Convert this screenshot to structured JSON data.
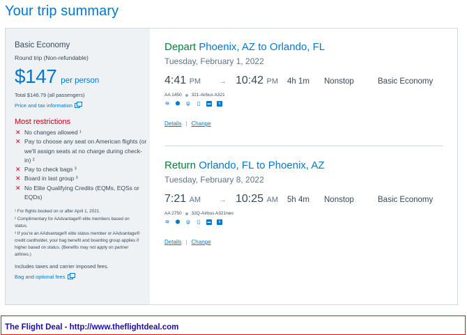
{
  "page": {
    "title": "Your trip summary"
  },
  "fare": {
    "name": "Basic Economy",
    "trip_type": "Round trip (Non-refundable)",
    "price": "$147",
    "per_person": "per person",
    "total": "Total $146.79 (all passengers)",
    "price_info_link": "Price and tax information",
    "restrictions_title": "Most restrictions",
    "restrictions": [
      "No changes allowed ¹",
      "Pay to choose any seat on American flights (or we'll assign seats at no charge during check-in) ²",
      "Pay to check bags ³",
      "Board in last group ³",
      "No Elite Qualifying Credits (EQMs, EQSs or EQDs)"
    ],
    "footnotes": [
      "¹ For flights booked on or after April 1, 2021.",
      "² Complimentary for AAdvantage® elite members based on status.",
      "³ If you're an AAdvantage® elite status member or AAdvantage® credit cardholder, your bag benefit and boarding group applies if higher based on status. (Benefits may not apply on partner airlines.)"
    ],
    "taxes_note": "Includes taxes and carrier imposed fees.",
    "bag_link": "Bag and optional fees"
  },
  "segments": [
    {
      "direction": "Depart",
      "route": "Phoenix, AZ to Orlando, FL",
      "date": "Tuesday, February 1, 2022",
      "depart_time": "4:41",
      "depart_ampm": "PM",
      "arrive_time": "10:42",
      "arrive_ampm": "PM",
      "duration": "4h 1m",
      "stops": "Nonstop",
      "cabin": "Basic Economy",
      "flight": "AA 1450",
      "aircraft": "321-Airbus A321",
      "details_link": "Details",
      "change_link": "Change"
    },
    {
      "direction": "Return",
      "route": "Orlando, FL to Phoenix, AZ",
      "date": "Tuesday, February 8, 2022",
      "depart_time": "7:21",
      "depart_ampm": "AM",
      "arrive_time": "10:25",
      "arrive_ampm": "AM",
      "duration": "5h 4m",
      "stops": "Nonstop",
      "cabin": "Basic Economy",
      "flight": "AA 2750",
      "aircraft": "32Q-Airbus A321neo",
      "details_link": "Details",
      "change_link": "Change"
    }
  ],
  "amenity_icons": [
    "wifi-icon",
    "shield-icon",
    "usb-icon",
    "phone-icon",
    "entertainment-icon",
    "power-icon"
  ],
  "arrow_glyph": "→",
  "separator": "|",
  "footer": {
    "deal_text": "The Flight Deal - http://www.theflightdeal.com"
  },
  "colors": {
    "accent": "#0078d2",
    "depart_green": "#00823b",
    "restriction_red": "#c30019",
    "sidebar_bg": "#eef2f5"
  }
}
